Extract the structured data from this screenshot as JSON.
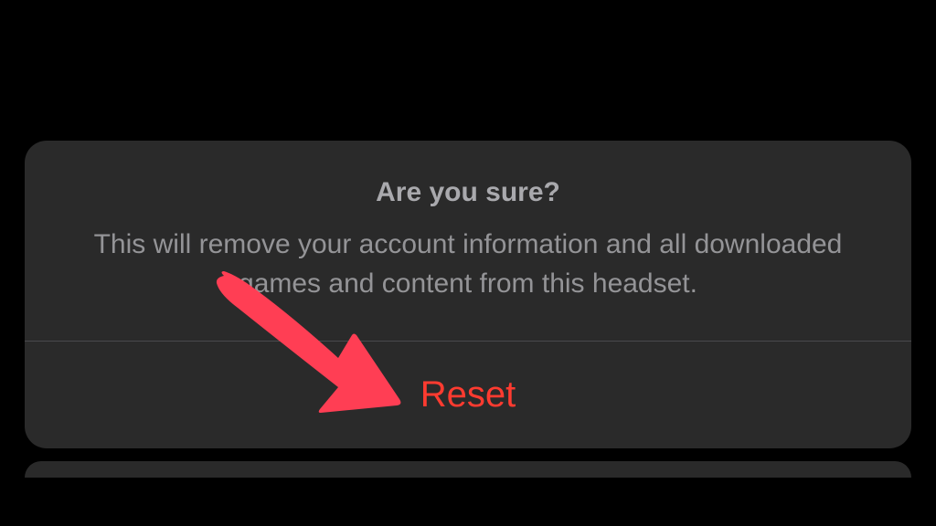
{
  "dialog": {
    "title": "Are you sure?",
    "message": "This will remove your account information and all downloaded games and content from this headset.",
    "reset_label": "Reset"
  },
  "colors": {
    "destructive": "#ff3b30",
    "annotation": "#ff3e54",
    "text_primary": "#a9a9ad",
    "text_secondary": "#949497",
    "sheet_bg": "#2a2a2a"
  }
}
